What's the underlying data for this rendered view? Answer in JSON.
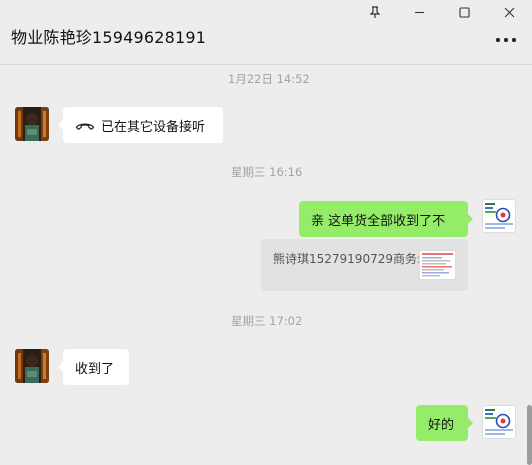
{
  "window": {
    "pin_icon": "pin-icon",
    "minimize_icon": "minimize-icon",
    "maximize_icon": "maximize-icon",
    "close_icon": "close-icon"
  },
  "chat": {
    "title": "物业陈艳珍15949628191",
    "more_icon": "more-icon"
  },
  "messages": [
    {
      "type": "timestamp",
      "text": "1月22日 14:52"
    },
    {
      "type": "call",
      "from": "contact",
      "icon": "phone-hangup-icon",
      "text": "已在其它设备接听"
    },
    {
      "type": "timestamp",
      "text": "星期三 16:16"
    },
    {
      "type": "text",
      "from": "me",
      "text": "亲 这单货全部收到了不"
    },
    {
      "type": "quote",
      "text": "熊诗琪15279190729商务:"
    },
    {
      "type": "timestamp",
      "text": "星期三 17:02"
    },
    {
      "type": "text",
      "from": "contact",
      "text": "收到了"
    },
    {
      "type": "text",
      "from": "me",
      "text": "好的"
    }
  ],
  "colors": {
    "background": "#ededed",
    "my_bubble": "#95ec69",
    "contact_bubble": "#ffffff",
    "quote_bg": "#e2e2e2",
    "timestamp_text": "#a3a3a3"
  }
}
